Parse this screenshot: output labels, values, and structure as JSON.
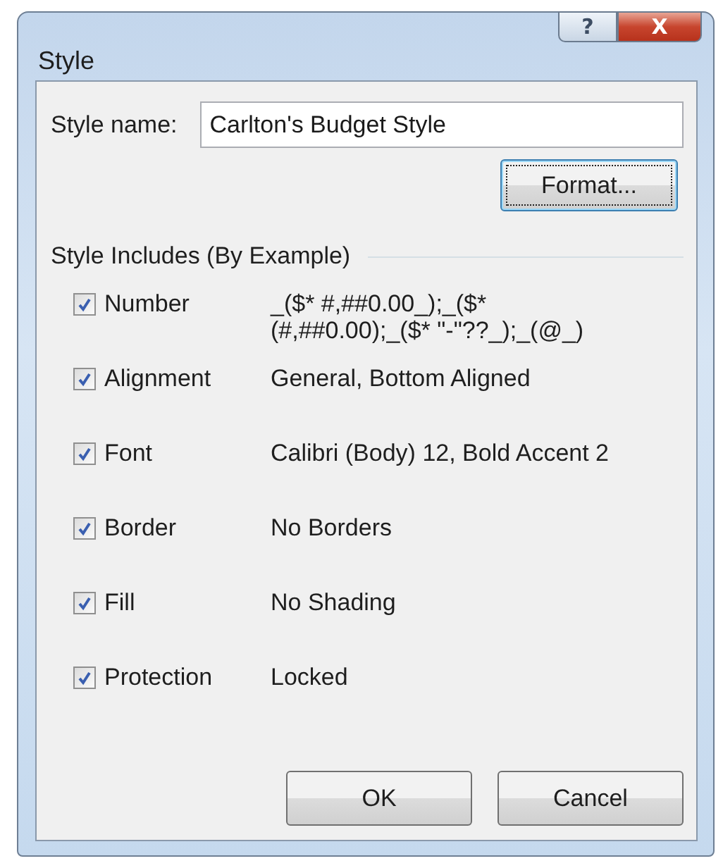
{
  "window": {
    "title": "Style",
    "help_button": "?",
    "close_button": "X"
  },
  "style_name": {
    "label": "Style name:",
    "value": "Carlton's Budget Style"
  },
  "format_button": {
    "label": "Format...",
    "focused": true
  },
  "group": {
    "title": "Style Includes (By Example)"
  },
  "items": [
    {
      "label": "Number",
      "checked": true,
      "value_lines": [
        "_($* #,##0.00_);_($*",
        "(#,##0.00);_($* \"-\"??_);_(@_)"
      ]
    },
    {
      "label": "Alignment",
      "checked": true,
      "value_lines": [
        "General, Bottom Aligned"
      ]
    },
    {
      "label": "Font",
      "checked": true,
      "value_lines": [
        "Calibri (Body) 12, Bold Accent 2"
      ]
    },
    {
      "label": "Border",
      "checked": true,
      "value_lines": [
        "No Borders"
      ]
    },
    {
      "label": "Fill",
      "checked": true,
      "value_lines": [
        "No Shading"
      ]
    },
    {
      "label": "Protection",
      "checked": true,
      "value_lines": [
        "Locked"
      ]
    }
  ],
  "buttons": [
    "OK",
    "Cancel"
  ]
}
